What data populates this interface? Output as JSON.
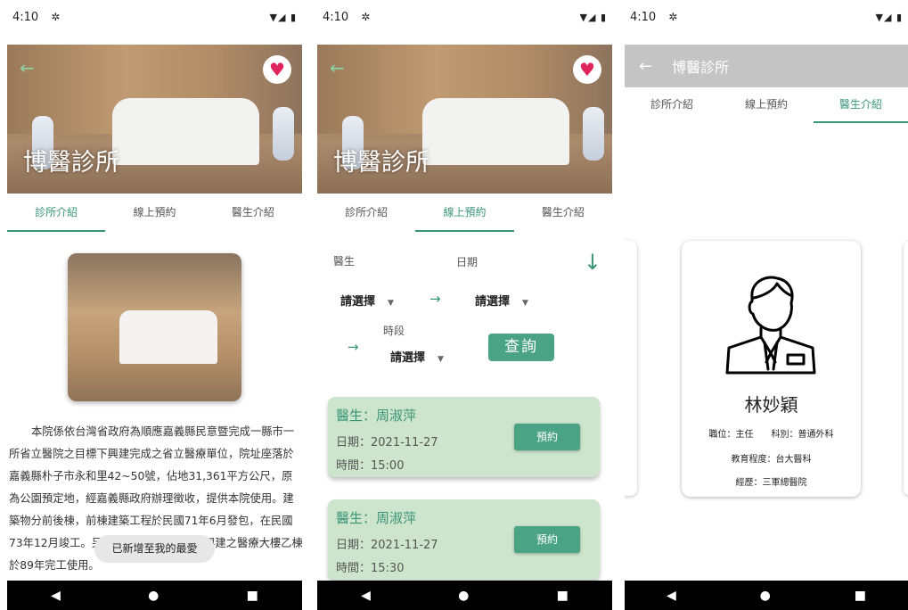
{
  "status": {
    "time": "4:10",
    "signal": "▼◢ ▮"
  },
  "clinic": {
    "name": "博醫診所"
  },
  "tabs": [
    "診所介紹",
    "線上預約",
    "醫生介紹"
  ],
  "panel1": {
    "intro": "本院係依台灣省政府為順應嘉義縣民意暨完成一縣市一所省立醫院之目標下興建完成之省立醫療單位，院址座落於嘉義縣朴子市永和里42~50號，佔地31,361平方公尺，原為公園預定地，經嘉義縣政府辦理徵收，提供本院使用。建築物分前後棟，前棟建築工程於民國71年6月發包，在民國73年12月竣工。另後棟於84年接受補助興建之醫療大樓乙棟於89年完工使用。",
    "toast": "已新增至我的最愛"
  },
  "panel2": {
    "doctor_label": "醫生",
    "date_label": "日期",
    "period_label": "時段",
    "select_placeholder": "請選擇",
    "query_button": "查詢",
    "appointments": [
      {
        "doctor": "醫生：周淑萍",
        "date": "日期：2021-11-27",
        "time": "時間：15:00",
        "book": "預約"
      },
      {
        "doctor": "醫生：周淑萍",
        "date": "日期：2021-11-27",
        "time": "時間：15:30",
        "book": "預約"
      }
    ]
  },
  "panel3": {
    "doctor": {
      "name": "林妙穎",
      "title_line": "職位：主任　　科別：普通外科",
      "education": "教育程度：台大醫科",
      "experience": "經歷：三軍總醫院"
    }
  },
  "icons": {
    "back": "back-arrow-icon",
    "heart": "heart-icon",
    "down": "down-arrow-icon",
    "doctor": "doctor-avatar-icon"
  },
  "colors": {
    "accent": "#3a9478",
    "card": "#cde5cc",
    "button": "#4aa385",
    "appbar": "#c4c4c4"
  }
}
